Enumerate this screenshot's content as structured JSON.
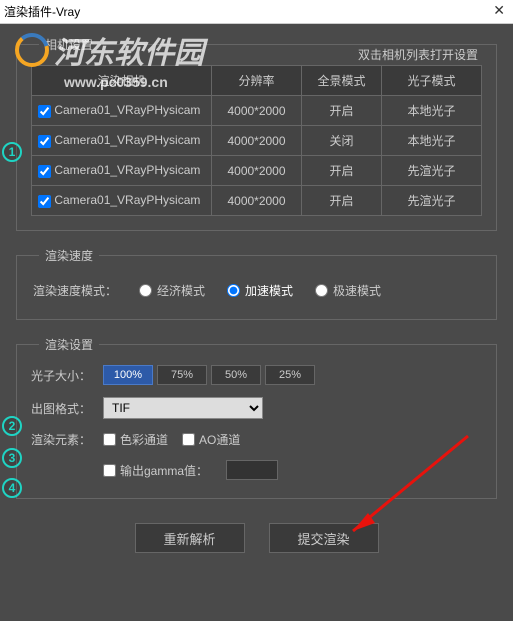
{
  "window": {
    "title": "渲染插件-Vray"
  },
  "watermark": {
    "text": "河东软件园",
    "url": "www.pc0359.cn"
  },
  "camera_section": {
    "title": "相机设置",
    "hint": "双击相机列表打开设置",
    "headers": [
      "渲染相机",
      "分辨率",
      "全景模式",
      "光子模式"
    ],
    "rows": [
      {
        "checked": true,
        "name": "Camera01_VRayPHysicam",
        "res": "4000*2000",
        "pano": "开启",
        "photon": "本地光子"
      },
      {
        "checked": true,
        "name": "Camera01_VRayPHysicam",
        "res": "4000*2000",
        "pano": "关闭",
        "photon": "本地光子"
      },
      {
        "checked": true,
        "name": "Camera01_VRayPHysicam",
        "res": "4000*2000",
        "pano": "开启",
        "photon": "先渲光子"
      },
      {
        "checked": true,
        "name": "Camera01_VRayPHysicam",
        "res": "4000*2000",
        "pano": "开启",
        "photon": "先渲光子"
      }
    ]
  },
  "speed_section": {
    "title": "渲染速度",
    "label": "渲染速度模式：",
    "options": [
      "经济模式",
      "加速模式",
      "极速模式"
    ],
    "selected": 1
  },
  "render_section": {
    "title": "渲染设置",
    "photon_size_label": "光子大小：",
    "photon_sizes": [
      "100%",
      "75%",
      "50%",
      "25%"
    ],
    "photon_selected": 0,
    "format_label": "出图格式：",
    "format_value": "TIF",
    "elements_label": "渲染元素：",
    "color_channel": "色彩通道",
    "ao_channel": "AO通道",
    "gamma_label": "输出gamma值：",
    "gamma_value": ""
  },
  "buttons": {
    "reparse": "重新解析",
    "submit": "提交渲染"
  }
}
